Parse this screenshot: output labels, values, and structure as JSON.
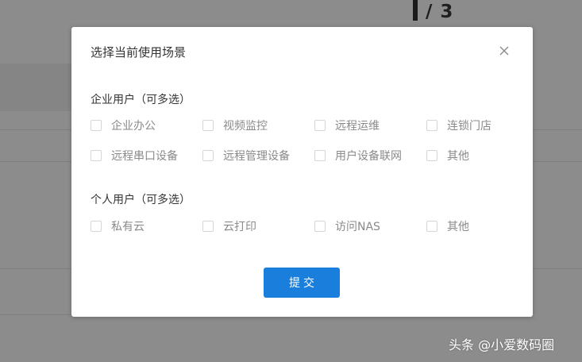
{
  "background": {
    "step_current": "",
    "step_total": "/ 3"
  },
  "dialog": {
    "title": "选择当前使用场景",
    "close_icon": "close-icon",
    "enterprise_section": {
      "title": "企业用户（可多选）",
      "options": [
        {
          "label": "企业办公",
          "checked": false
        },
        {
          "label": "视频监控",
          "checked": false
        },
        {
          "label": "远程运维",
          "checked": false
        },
        {
          "label": "连锁门店",
          "checked": false
        },
        {
          "label": "远程串口设备",
          "checked": false
        },
        {
          "label": "远程管理设备",
          "checked": false
        },
        {
          "label": "用户设备联网",
          "checked": false
        },
        {
          "label": "其他",
          "checked": false
        }
      ]
    },
    "personal_section": {
      "title": "个人用户（可多选）",
      "options": [
        {
          "label": "私有云",
          "checked": false
        },
        {
          "label": "云打印",
          "checked": false
        },
        {
          "label": "访问NAS",
          "checked": false
        },
        {
          "label": "其他",
          "checked": false
        }
      ]
    },
    "submit_label": "提交"
  },
  "watermark": {
    "text": "头条 @小爱数码圈"
  },
  "colors": {
    "accent": "#1a7fdc",
    "overlay": "#8c8c8c",
    "text_primary": "#333333",
    "text_secondary": "#8a8a8a"
  }
}
